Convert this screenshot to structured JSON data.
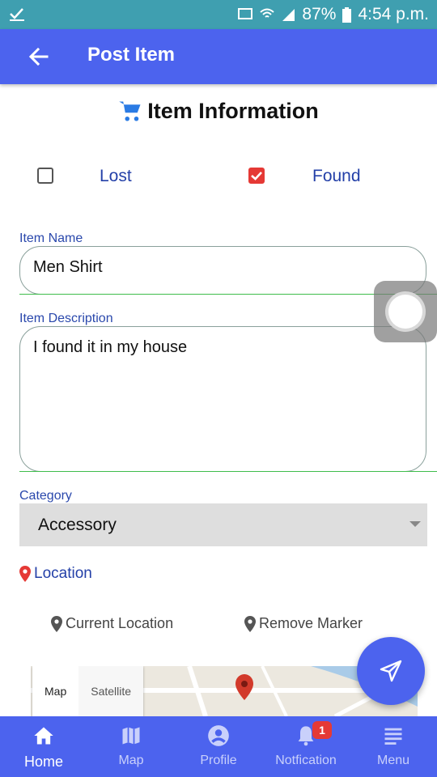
{
  "status_bar": {
    "battery": "87%",
    "time": "4:54 p.m."
  },
  "app_bar": {
    "title": "Post Item"
  },
  "section": {
    "title": "Item Information"
  },
  "type_choice": {
    "lost": {
      "label": "Lost",
      "checked": false
    },
    "found": {
      "label": "Found",
      "checked": true
    }
  },
  "item_name": {
    "label": "Item Name",
    "value": "Men Shirt"
  },
  "item_description": {
    "label": "Item Description",
    "value": "I found it in my house"
  },
  "category": {
    "label": "Category",
    "selected": "Accessory"
  },
  "location": {
    "heading": "Location",
    "current_location": "Current Location",
    "remove_marker": "Remove Marker"
  },
  "map": {
    "tab_map": "Map",
    "tab_satellite": "Satellite"
  },
  "bottom_nav": {
    "home": "Home",
    "map": "Map",
    "profile": "Profile",
    "notification": "Notfication",
    "menu": "Menu",
    "notification_badge": "1"
  },
  "colors": {
    "primary": "#4c63ee",
    "accent": "#e53935",
    "status_bar": "#3f9fb0"
  }
}
